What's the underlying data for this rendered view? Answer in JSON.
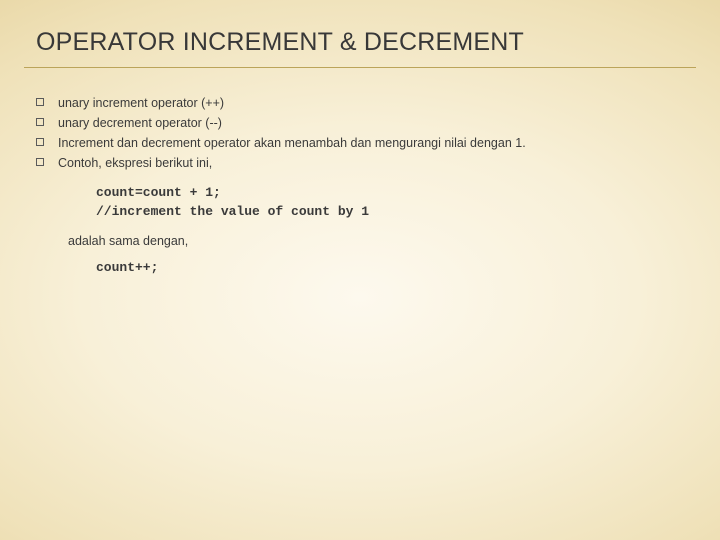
{
  "title": "OPERATOR INCREMENT & DECREMENT",
  "bullets": [
    "unary increment operator (++)",
    "unary decrement operator (--)",
    "Increment dan decrement operator akan menambah dan mengurangi nilai dengan 1.",
    "Contoh, ekspresi berikut ini,"
  ],
  "code1": "count=count + 1;\n//increment the value of count by 1",
  "intertext": "adalah sama dengan,",
  "code2": "count++;"
}
